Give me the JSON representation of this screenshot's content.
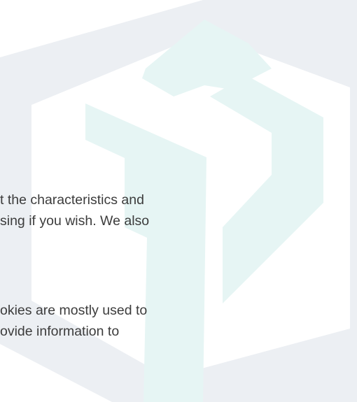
{
  "watermark": {
    "icon": "hexagon-logo-watermark-icon",
    "colors": {
      "hexagon": "#eceff3",
      "cube": "#e6f5f4"
    }
  },
  "paragraphs": [
    {
      "lines": [
        "t the characteristics and",
        "sing if you wish. We also"
      ]
    },
    {
      "lines": [
        "okies are mostly used to",
        "ovide information to"
      ]
    }
  ]
}
